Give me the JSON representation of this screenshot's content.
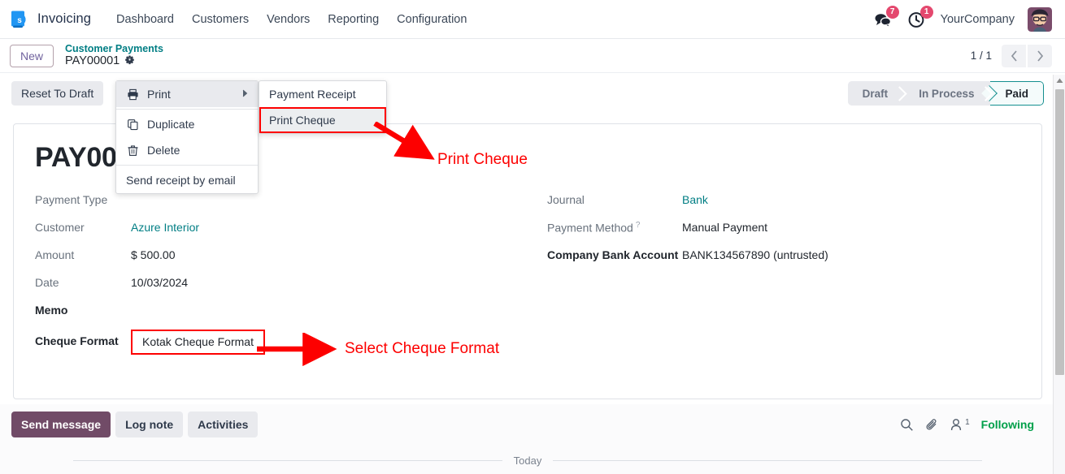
{
  "navbar": {
    "app_icon": "invoicing-app-icon",
    "brand": "Invoicing",
    "menu_items": [
      {
        "label": "Dashboard"
      },
      {
        "label": "Customers"
      },
      {
        "label": "Vendors"
      },
      {
        "label": "Reporting"
      },
      {
        "label": "Configuration"
      }
    ],
    "messages_icon": "messages-icon",
    "messages_count": "7",
    "activities_icon": "activities-clock-icon",
    "activities_count": "1",
    "company": "YourCompany",
    "avatar": "user-avatar"
  },
  "breadcrumb": {
    "new_label": "New",
    "parent": "Customer Payments",
    "current": "PAY00001",
    "gear_icon": "gear-icon"
  },
  "pager": {
    "count": "1 / 1",
    "prev_icon": "chevron-left-icon",
    "next_icon": "chevron-right-icon"
  },
  "control_panel": {
    "reset_label": "Reset To Draft",
    "statuses": [
      {
        "label": "Draft",
        "active": false
      },
      {
        "label": "In Process",
        "active": false
      },
      {
        "label": "Paid",
        "active": true
      }
    ]
  },
  "record": {
    "title": "PAY00001",
    "left_fields": [
      {
        "label": "Payment Type",
        "value": "",
        "link": false,
        "bold_label": false
      },
      {
        "label": "Customer",
        "value": "Azure Interior",
        "link": true,
        "bold_label": false
      },
      {
        "label": "Amount",
        "value": "$ 500.00",
        "link": false,
        "bold_label": false
      },
      {
        "label": "Date",
        "value": "10/03/2024",
        "link": false,
        "bold_label": false
      },
      {
        "label": "Memo",
        "value": "",
        "link": false,
        "bold_label": true
      }
    ],
    "cheque_format": {
      "label": "Cheque Format",
      "value": "Kotak Cheque Format"
    },
    "right_fields": [
      {
        "label": "Journal",
        "value": "Bank",
        "link": true,
        "bold_label": false,
        "help": false
      },
      {
        "label": "Payment Method",
        "value": "Manual Payment",
        "link": false,
        "bold_label": false,
        "help": true
      },
      {
        "label": "Company Bank Account",
        "value": "BANK134567890 (untrusted)",
        "link": false,
        "bold_label": true,
        "help": false
      }
    ]
  },
  "menu_main": {
    "items": [
      {
        "label": "Print",
        "icon": "printer-icon",
        "submenu": true,
        "highlight": true
      },
      {
        "label": "Duplicate",
        "icon": "duplicate-icon",
        "submenu": false,
        "highlight": false
      },
      {
        "label": "Delete",
        "icon": "trash-icon",
        "submenu": false,
        "highlight": false
      },
      {
        "label": "Send receipt by email",
        "icon": "",
        "submenu": false,
        "highlight": false
      }
    ]
  },
  "menu_sub": {
    "items": [
      {
        "label": "Payment Receipt",
        "boxed": false
      },
      {
        "label": "Print Cheque",
        "boxed": true
      }
    ]
  },
  "annotations": [
    {
      "text": "Print Cheque",
      "color": "#fd0000"
    },
    {
      "text": "Select Cheque Format",
      "color": "#fd0000"
    }
  ],
  "chatter": {
    "send_message": "Send message",
    "log_note": "Log note",
    "activities": "Activities",
    "search_icon": "search-icon",
    "attachment_icon": "paperclip-icon",
    "follower_icon": "follower-person-icon",
    "follower_count": "1",
    "following_label": "Following",
    "today_label": "Today"
  },
  "colors": {
    "brand_purple": "#714b67",
    "teal_link": "#017e84",
    "annotation_red": "#fd0000",
    "status_active_border": "#148f8f",
    "following_green": "#00a04a",
    "badge_red": "#e4486e"
  }
}
